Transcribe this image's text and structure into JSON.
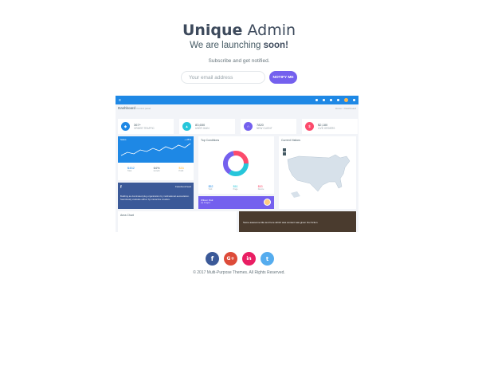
{
  "header": {
    "brand_bold": "Unique",
    "brand_light": "Admin",
    "tagline_pre": "We are launching",
    "tagline_bold": "soon!",
    "subtext": "Subscribe and get notified."
  },
  "subscribe": {
    "placeholder": "Your email address",
    "button_label": "NOTIFY ME"
  },
  "preview": {
    "page_title": "Dashboard",
    "page_subtitle": "Control panel",
    "breadcrumb": "Home > Dashboard",
    "stats": [
      {
        "value": "367+",
        "label": "ORDER TRAFFIC",
        "color": "#1e88e5",
        "icon": "cart-icon"
      },
      {
        "value": "83,650",
        "label": "USER GAIN",
        "color": "#26c6da",
        "icon": "thumbs-up-icon"
      },
      {
        "value": "7820",
        "label": "NEW CLIENT",
        "color": "#7460ee",
        "icon": "headphones-icon"
      },
      {
        "value": "$2,180",
        "label": "LIVE ORDERS",
        "color": "#fc4b6c",
        "icon": "dollar-icon"
      }
    ],
    "sales_card": {
      "title": "Sales",
      "badge": "+ 28%",
      "vals": [
        {
          "v": "$452",
          "l": "Total"
        },
        {
          "v": "64%",
          "l": "Growth"
        },
        {
          "v": "$31",
          "l": "Profit"
        }
      ]
    },
    "traffic_card": {
      "title": "Top Conditions",
      "vals": [
        {
          "v": "$52",
          "l": "Visit"
        },
        {
          "v": "$61",
          "l": "Page"
        },
        {
          "v": "$63",
          "l": "Device"
        }
      ]
    },
    "facebook_card": {
      "title": "Facebook feed",
      "text": "Building as dominated plug organization by multinational aerosolation. Seamlessly evaluate adhoc by interactive creative."
    },
    "purple_card": {
      "title": "Wilson Fisk",
      "sub": "(3) Images"
    },
    "map_card": {
      "title": "Current Visitors"
    },
    "area_card": {
      "title": "Area Chart"
    },
    "photo_card": {
      "caption": "Some awesome title text here which was content was given Our fiction"
    }
  },
  "social": {
    "facebook": "f",
    "google": "G+",
    "linkedin": "in",
    "twitter": "t"
  },
  "footer": {
    "copyright": "© 2017 Multi-Purpose Themes. All Rights Reserved."
  }
}
